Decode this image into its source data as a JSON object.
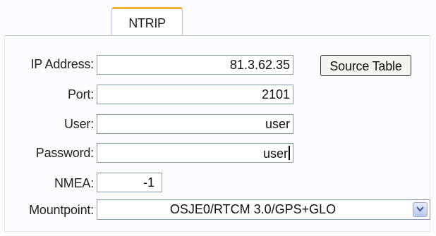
{
  "tab": {
    "label": "NTRIP"
  },
  "form": {
    "ip_label": "IP Address:",
    "ip_value": "81.3.62.35",
    "port_label": "Port:",
    "port_value": "2101",
    "user_label": "User:",
    "user_value": "user",
    "password_label": "Password:",
    "password_value": "user",
    "nmea_label": "NMEA:",
    "nmea_value": "-1",
    "mountpoint_label": "Mountpoint:",
    "mountpoint_value": "OSJE0/RTCM 3.0/GPS+GLO"
  },
  "buttons": {
    "source_table": "Source Table"
  },
  "icons": {
    "dropdown": "chevron-down-icon"
  },
  "colors": {
    "tab_accent": "#f5b13a",
    "border": "#8a98ad"
  }
}
